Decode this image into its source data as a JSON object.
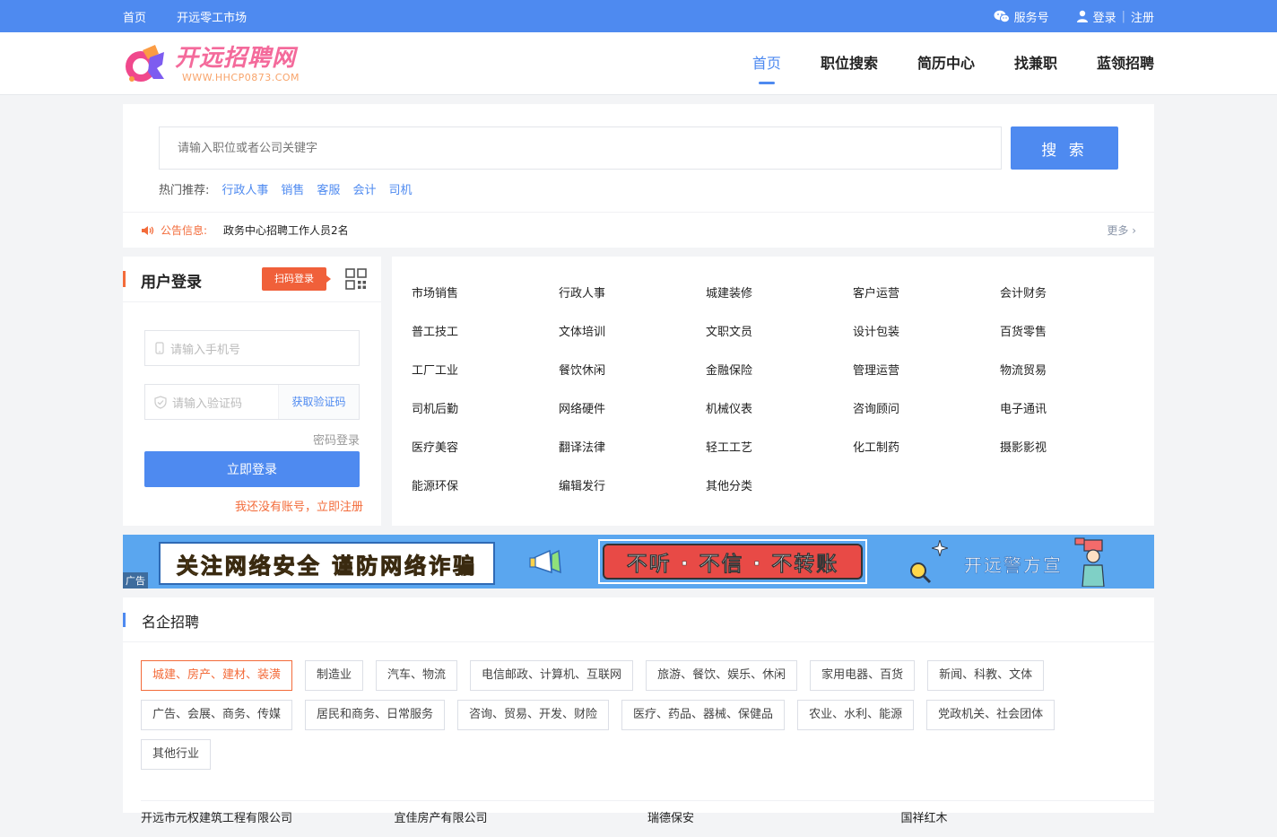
{
  "topbar": {
    "links": [
      "首页",
      "开远零工市场"
    ],
    "service": "服务号",
    "login": "登录",
    "register": "注册"
  },
  "header": {
    "logo_title": "开远招聘网",
    "logo_url": "WWW.HHCP0873.COM",
    "nav": [
      "首页",
      "职位搜索",
      "简历中心",
      "找兼职",
      "蓝领招聘"
    ],
    "active_nav": "首页"
  },
  "search": {
    "placeholder": "请输入职位或者公司关键字",
    "button": "搜 索",
    "hot_label": "热门推荐:",
    "hot_tags": [
      "行政人事",
      "销售",
      "客服",
      "会计",
      "司机"
    ]
  },
  "notice": {
    "label": "公告信息:",
    "message": "政务中心招聘工作人员2名",
    "more": "更多"
  },
  "login": {
    "title": "用户登录",
    "scan_button": "扫码登录",
    "phone_placeholder": "请输入手机号",
    "code_placeholder": "请输入验证码",
    "get_code": "获取验证码",
    "password_login": "密码登录",
    "submit": "立即登录",
    "register_link": "我还没有账号，立即注册"
  },
  "categories": [
    "市场销售",
    "行政人事",
    "城建装修",
    "客户运营",
    "会计财务",
    "普工技工",
    "文体培训",
    "文职文员",
    "设计包装",
    "百货零售",
    "工厂工业",
    "餐饮休闲",
    "金融保险",
    "管理运营",
    "物流贸易",
    "司机后勤",
    "网络硬件",
    "机械仪表",
    "咨询顾问",
    "电子通讯",
    "医疗美容",
    "翻译法律",
    "轻工工艺",
    "化工制药",
    "摄影影视",
    "能源环保",
    "编辑发行",
    "其他分类"
  ],
  "banner": {
    "ad_label": "广告",
    "slogan1": "关注网络安全 谨防网络诈骗",
    "slogan2": "不听 · 不信 · 不转账",
    "slogan3": "开远警方宣"
  },
  "companies": {
    "title": "名企招聘",
    "industries": [
      "城建、房产、建材、装潢",
      "制造业",
      "汽车、物流",
      "电信邮政、计算机、互联网",
      "旅游、餐饮、娱乐、休闲",
      "家用电器、百货",
      "新闻、科教、文体",
      "广告、会展、商务、传媒",
      "居民和商务、日常服务",
      "咨询、贸易、开发、财险",
      "医疗、药品、器械、保健品",
      "农业、水利、能源",
      "党政机关、社会团体",
      "其他行业"
    ],
    "active_industry": "城建、房产、建材、装潢",
    "names": [
      "开远市元权建筑工程有限公司",
      "宜佳房产有限公司",
      "瑞德保安",
      "国祥红木"
    ]
  },
  "colors": {
    "primary": "#4e8af0",
    "accent": "#f36b3a"
  }
}
